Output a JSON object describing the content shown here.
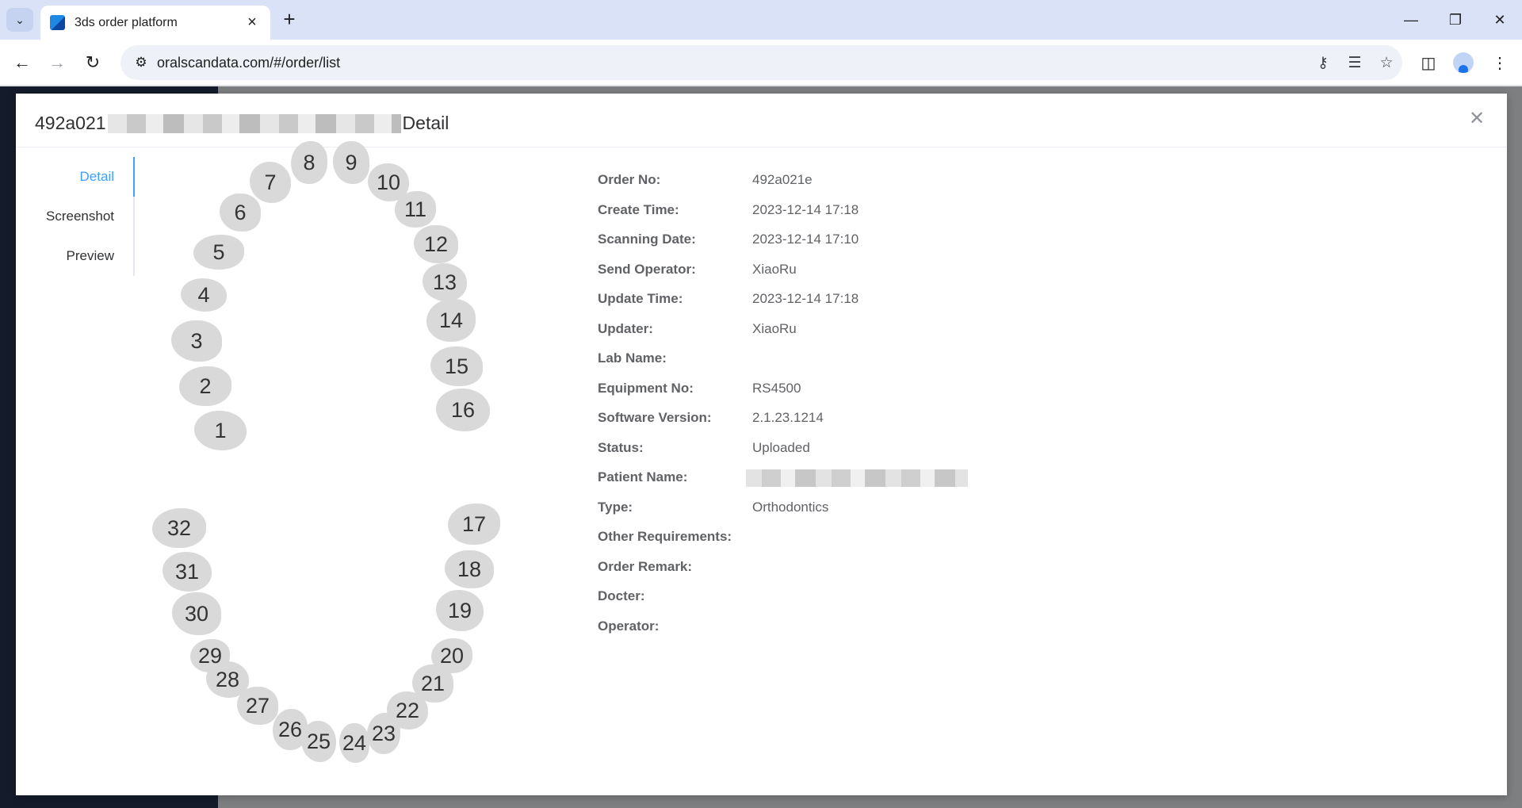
{
  "browser": {
    "tab_title": "3ds order platform",
    "url": "oralscandata.com/#/order/list"
  },
  "modal": {
    "title_prefix": "492a021",
    "title_suffix": "Detail",
    "tabs": [
      {
        "label": "Detail",
        "active": true
      },
      {
        "label": "Screenshot",
        "active": false
      },
      {
        "label": "Preview",
        "active": false
      }
    ]
  },
  "teeth": [
    "1",
    "2",
    "3",
    "4",
    "5",
    "6",
    "7",
    "8",
    "9",
    "10",
    "11",
    "12",
    "13",
    "14",
    "15",
    "16",
    "17",
    "18",
    "19",
    "20",
    "21",
    "22",
    "23",
    "24",
    "25",
    "26",
    "27",
    "28",
    "29",
    "30",
    "31",
    "32"
  ],
  "details": [
    {
      "label": "Order No:",
      "value": "492a021e"
    },
    {
      "label": "Create Time:",
      "value": "2023-12-14 17:18"
    },
    {
      "label": "Scanning Date:",
      "value": "2023-12-14 17:10"
    },
    {
      "label": "Send Operator:",
      "value": "XiaoRu"
    },
    {
      "label": "Update Time:",
      "value": "2023-12-14 17:18"
    },
    {
      "label": "Updater:",
      "value": "XiaoRu"
    },
    {
      "label": "Lab Name:",
      "value": ""
    },
    {
      "label": "Equipment No:",
      "value": "RS4500"
    },
    {
      "label": "Software Version:",
      "value": "2.1.23.1214"
    },
    {
      "label": "Status:",
      "value": "Uploaded"
    },
    {
      "label": "Patient Name:",
      "value": ""
    },
    {
      "label": "Type:",
      "value": "Orthodontics"
    },
    {
      "label": "Other Requirements:",
      "value": ""
    },
    {
      "label": "Order Remark:",
      "value": ""
    },
    {
      "label": "Docter:",
      "value": ""
    },
    {
      "label": "Operator:",
      "value": ""
    }
  ],
  "colors": {
    "accent": "#409eff",
    "tooth": "#d9d9d9"
  }
}
